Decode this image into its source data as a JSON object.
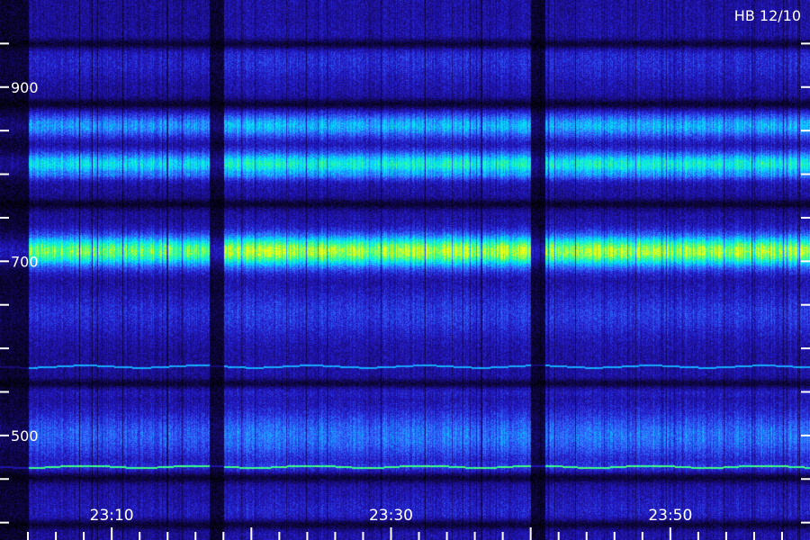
{
  "chart_data": {
    "type": "heatmap",
    "title": "HB 12/10",
    "xlabel": "",
    "ylabel": "",
    "x_ticks": [
      "23:10",
      "23:30",
      "23:50"
    ],
    "x_range": [
      "23:02",
      "24:00"
    ],
    "y_ticks": [
      900,
      700,
      500
    ],
    "y_range": [
      380,
      1000
    ],
    "grid": false,
    "gaps": [
      {
        "start": "23:02",
        "end": "23:04"
      },
      {
        "start": "23:17",
        "end": "23:18"
      },
      {
        "start": "23:40",
        "end": "23:41"
      }
    ],
    "bands": [
      {
        "center": 930,
        "width": 22,
        "level": 0.35
      },
      {
        "center": 856,
        "width": 14,
        "level": 0.58
      },
      {
        "center": 812,
        "width": 14,
        "level": 0.7
      },
      {
        "center": 802,
        "width": 8,
        "level": 0.55
      },
      {
        "center": 712,
        "width": 18,
        "level": 0.9
      },
      {
        "center": 640,
        "width": 26,
        "level": 0.38
      },
      {
        "center": 555,
        "width": 12,
        "level": 0.33
      },
      {
        "center": 500,
        "width": 28,
        "level": 0.48
      },
      {
        "center": 465,
        "width": 12,
        "level": 0.37
      },
      {
        "center": 413,
        "width": 20,
        "level": 0.32
      }
    ],
    "dark_bands": [
      950,
      881,
      766,
      560,
      452,
      398
    ],
    "traces": [
      {
        "value": 465,
        "level": 0.85
      },
      {
        "value": 580,
        "level": 0.6
      }
    ]
  },
  "colors": {
    "background": "#08052a",
    "tick_labels": "#ffffff",
    "colormap": [
      "#000000",
      "#12085a",
      "#2418c8",
      "#2f6bff",
      "#00e1ff",
      "#31ff8a",
      "#f2ff12"
    ]
  }
}
